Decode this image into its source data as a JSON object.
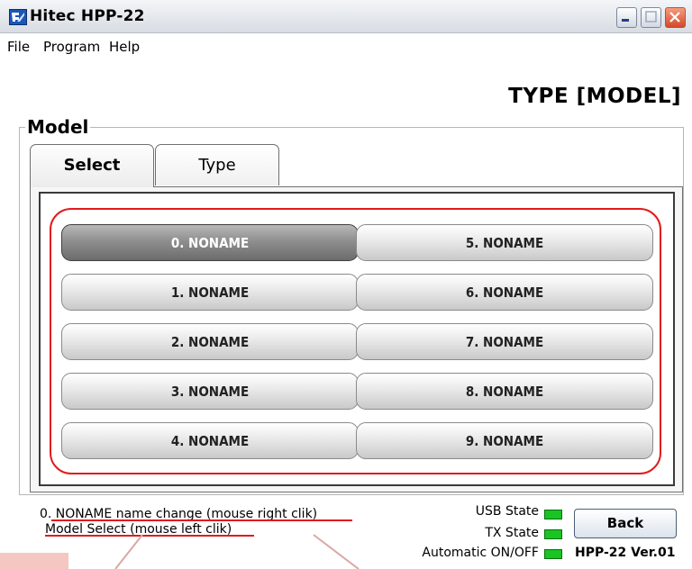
{
  "window": {
    "title": "Hitec HPP-22",
    "icon": "hitec-app-icon"
  },
  "menu": {
    "items": [
      "File",
      "Program",
      "Help"
    ]
  },
  "page": {
    "heading": "TYPE [MODEL]",
    "group_label": "Model"
  },
  "tabs": [
    {
      "label": "Select",
      "active": true
    },
    {
      "label": "Type",
      "active": false
    }
  ],
  "models": [
    {
      "label": "0. NONAME",
      "selected": true
    },
    {
      "label": "1. NONAME",
      "selected": false
    },
    {
      "label": "2. NONAME",
      "selected": false
    },
    {
      "label": "3. NONAME",
      "selected": false
    },
    {
      "label": "4. NONAME",
      "selected": false
    },
    {
      "label": "5. NONAME",
      "selected": false
    },
    {
      "label": "6. NONAME",
      "selected": false
    },
    {
      "label": "7. NONAME",
      "selected": false
    },
    {
      "label": "8. NONAME",
      "selected": false
    },
    {
      "label": "9. NONAME",
      "selected": false
    }
  ],
  "hints": {
    "line1": "0. NONAME name change (mouse right clik)",
    "line2": "Model Select (mouse left clik)"
  },
  "status": {
    "usb_label": "USB State",
    "tx_label": "TX State",
    "auto_label": "Automatic ON/OFF",
    "led_color": "#19c423"
  },
  "back_button": "Back",
  "version": "HPP-22 Ver.01",
  "colors": {
    "annotation_red": "#e11b1b",
    "selected_button": "#8f8f8f"
  }
}
